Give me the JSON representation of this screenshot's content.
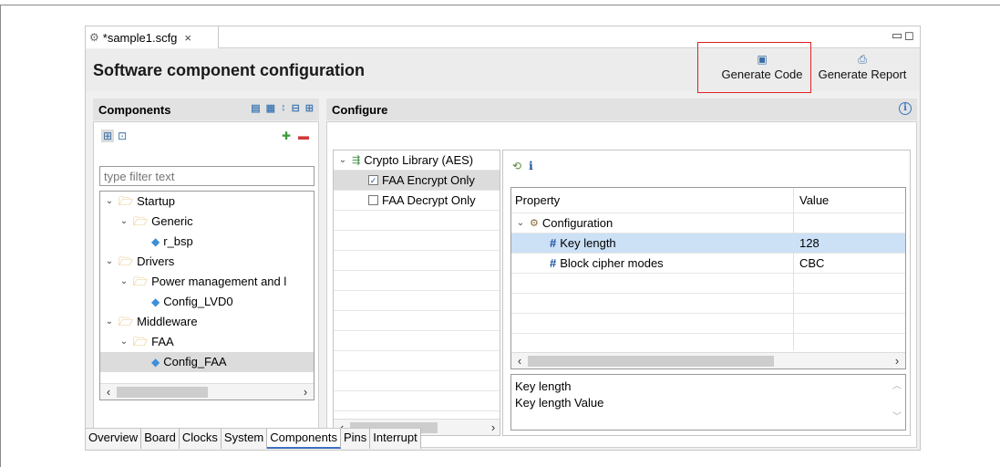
{
  "editor_tab": {
    "title": "*sample1.scfg",
    "close": "×"
  },
  "window_controls": {
    "minimize": "▭",
    "maximize": "◻"
  },
  "header": {
    "title": "Software component configuration",
    "generate_code_label": "Generate Code",
    "generate_report_label": "Generate Report"
  },
  "components": {
    "title": "Components",
    "filter_placeholder": "type filter text",
    "tree": [
      {
        "label": "Startup",
        "level": 0,
        "kind": "folder",
        "expanded": true
      },
      {
        "label": "Generic",
        "level": 1,
        "kind": "folder",
        "expanded": true
      },
      {
        "label": "r_bsp",
        "level": 2,
        "kind": "component"
      },
      {
        "label": "Drivers",
        "level": 0,
        "kind": "folder",
        "expanded": true
      },
      {
        "label": "Power management and l",
        "level": 1,
        "kind": "folder",
        "expanded": true
      },
      {
        "label": "Config_LVD0",
        "level": 2,
        "kind": "component"
      },
      {
        "label": "Middleware",
        "level": 0,
        "kind": "folder",
        "expanded": true
      },
      {
        "label": "FAA",
        "level": 1,
        "kind": "folder",
        "expanded": true
      },
      {
        "label": "Config_FAA",
        "level": 2,
        "kind": "component",
        "selected": true
      }
    ]
  },
  "configure": {
    "title": "Configure",
    "info_icon": "i",
    "feature_root": "Crypto Library (AES)",
    "features": [
      {
        "label": "FAA Encrypt Only",
        "checked": true,
        "selected": true
      },
      {
        "label": "FAA Decrypt Only",
        "checked": false,
        "selected": false
      }
    ],
    "toolbar_info": "i",
    "prop_headers": {
      "property": "Property",
      "value": "Value"
    },
    "properties": {
      "group": "Configuration",
      "rows": [
        {
          "name": "Key length",
          "value": "128",
          "selected": true
        },
        {
          "name": "Block cipher modes",
          "value": "CBC",
          "selected": false
        }
      ]
    },
    "description": {
      "line1": "Key length",
      "line2": "Key length Value"
    }
  },
  "bottom_tabs": [
    "Overview",
    "Board",
    "Clocks",
    "System",
    "Components",
    "Pins",
    "Interrupt"
  ],
  "active_bottom_tab": "Components"
}
